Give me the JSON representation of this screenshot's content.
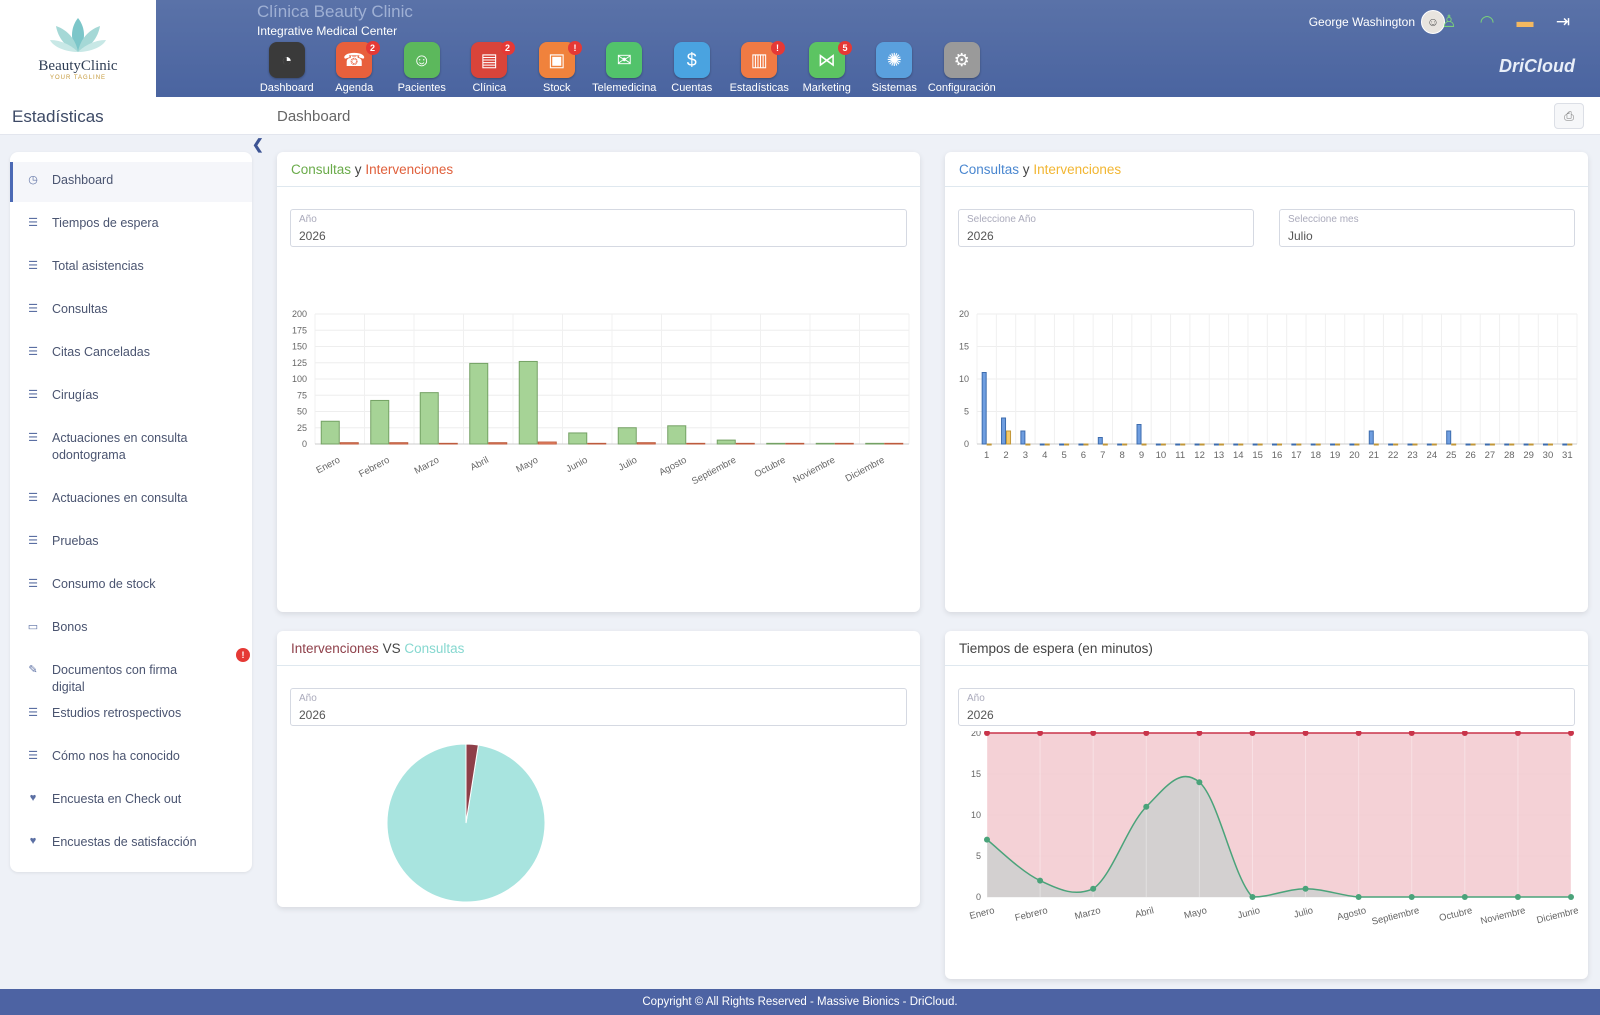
{
  "brand": {
    "logo_name": "BeautyClinic",
    "logo_tagline": "YOUR TAGLINE",
    "clinic_name": "Clínica Beauty Clinic",
    "clinic_sub": "Integrative Medical Center",
    "cloud": "DriCloud"
  },
  "nav": [
    {
      "label": "Dashboard",
      "color": "#3a3a3a",
      "icon": "◔",
      "badge": ""
    },
    {
      "label": "Agenda",
      "color": "#e8603c",
      "icon": "☎",
      "badge": "2"
    },
    {
      "label": "Pacientes",
      "color": "#5cb85c",
      "icon": "☺",
      "badge": ""
    },
    {
      "label": "Clínica",
      "color": "#d9443a",
      "icon": "▤",
      "badge": "2"
    },
    {
      "label": "Stock",
      "color": "#f0823c",
      "icon": "▣",
      "badge": "!"
    },
    {
      "label": "Telemedicina",
      "color": "#52c36b",
      "icon": "✉",
      "badge": ""
    },
    {
      "label": "Cuentas",
      "color": "#4aa3e0",
      "icon": "$",
      "badge": ""
    },
    {
      "label": "Estadísticas",
      "color": "#f07a44",
      "icon": "▥",
      "badge": "!"
    },
    {
      "label": "Marketing",
      "color": "#5cc462",
      "icon": "⋈",
      "badge": "5"
    },
    {
      "label": "Sistemas",
      "color": "#5aa0dd",
      "icon": "✺",
      "badge": ""
    },
    {
      "label": "Configuración",
      "color": "#9a9a9a",
      "icon": "⚙",
      "badge": ""
    }
  ],
  "user": {
    "name": "George Washington"
  },
  "page": {
    "section": "Estadísticas",
    "breadcrumb": "Dashboard"
  },
  "sidebar": [
    {
      "label": "Dashboard",
      "icon": "◷",
      "active": true
    },
    {
      "label": "Tiempos de espera",
      "icon": "☰"
    },
    {
      "label": "Total asistencias",
      "icon": "☰"
    },
    {
      "label": "Consultas",
      "icon": "☰"
    },
    {
      "label": "Citas Canceladas",
      "icon": "☰"
    },
    {
      "label": "Cirugías",
      "icon": "☰"
    },
    {
      "label": "Actuaciones en consulta odontograma",
      "icon": "☰"
    },
    {
      "label": "Actuaciones en consulta",
      "icon": "☰"
    },
    {
      "label": "Pruebas",
      "icon": "☰"
    },
    {
      "label": "Consumo de stock",
      "icon": "☰"
    },
    {
      "label": "Bonos",
      "icon": "▭"
    },
    {
      "label": "Documentos con firma digital",
      "icon": "✎",
      "badge": "!"
    },
    {
      "label": "Estudios retrospectivos",
      "icon": "☰"
    },
    {
      "label": "Cómo nos ha conocido",
      "icon": "☰"
    },
    {
      "label": "Encuesta en Check out",
      "icon": "♥"
    },
    {
      "label": "Encuestas de satisfacción",
      "icon": "♥"
    }
  ],
  "cards": {
    "c1": {
      "title_a": "Consultas",
      "title_mid": " y ",
      "title_b": "Intervenciones",
      "field_label": "Año",
      "field_value": "2026"
    },
    "c2": {
      "title_a": "Consultas",
      "title_mid": " y ",
      "title_b": "Intervenciones",
      "field1_label": "Seleccione Año",
      "field1_value": "2026",
      "field2_label": "Seleccione mes",
      "field2_value": "Julio"
    },
    "c3": {
      "title_a": "Intervenciones",
      "title_mid": " VS ",
      "title_b": "Consultas",
      "field_label": "Año",
      "field_value": "2026"
    },
    "c4": {
      "title": "Tiempos de espera (en minutos)",
      "field_label": "Año",
      "field_value": "2026"
    }
  },
  "footer": "Copyright © All Rights Reserved - Massive Bionics - DriCloud.",
  "chart_data": [
    {
      "type": "bar",
      "categories": [
        "Enero",
        "Febrero",
        "Marzo",
        "Abril",
        "Mayo",
        "Junio",
        "Julio",
        "Agosto",
        "Septiembre",
        "Octubre",
        "Noviembre",
        "Diciembre"
      ],
      "series": [
        {
          "values": [
            35,
            67,
            79,
            124,
            127,
            17,
            25,
            28,
            6,
            1,
            1,
            1
          ],
          "color": "#a6d396"
        },
        {
          "values": [
            2,
            2,
            1,
            2,
            3,
            1,
            2,
            1,
            1,
            1,
            1,
            1
          ],
          "color": "#ef8d6f"
        }
      ],
      "ylim": [
        0,
        200
      ],
      "yticks": [
        0,
        25,
        50,
        75,
        100,
        125,
        150,
        175,
        200
      ]
    },
    {
      "type": "bar",
      "categories": [
        "1",
        "2",
        "3",
        "4",
        "5",
        "6",
        "7",
        "8",
        "9",
        "10",
        "11",
        "12",
        "13",
        "14",
        "15",
        "16",
        "17",
        "18",
        "19",
        "20",
        "21",
        "22",
        "23",
        "24",
        "25",
        "26",
        "27",
        "28",
        "29",
        "30",
        "31"
      ],
      "series": [
        {
          "values": [
            11,
            4,
            2,
            0,
            0,
            0,
            1,
            0,
            3,
            0,
            0,
            0,
            0,
            0,
            0,
            0,
            0,
            0,
            0,
            0,
            2,
            0,
            0,
            0,
            2,
            0,
            0,
            0,
            0,
            0,
            0
          ],
          "color": "#6f9ee0"
        },
        {
          "values": [
            0,
            2,
            0,
            0,
            0,
            0,
            0,
            0,
            0,
            0,
            0,
            0,
            0,
            0,
            0,
            0,
            0,
            0,
            0,
            0,
            0,
            0,
            0,
            0,
            0,
            0,
            0,
            0,
            0,
            0,
            0
          ],
          "color": "#f4c96a"
        }
      ],
      "ylim": [
        0,
        20
      ],
      "yticks": [
        0,
        5,
        10,
        15,
        20
      ]
    },
    {
      "type": "pie",
      "slices": [
        {
          "value": 97.5,
          "color": "#a8e4df"
        },
        {
          "value": 2.5,
          "color": "#8e3f49"
        }
      ]
    },
    {
      "type": "area",
      "categories": [
        "Enero",
        "Febrero",
        "Marzo",
        "Abril",
        "Mayo",
        "Junio",
        "Julio",
        "Agosto",
        "Septiembre",
        "Octubre",
        "Noviembre",
        "Diciembre"
      ],
      "series": [
        {
          "values": [
            20,
            20,
            20,
            20,
            20,
            20,
            20,
            20,
            20,
            20,
            20,
            20
          ],
          "color": "#c9344a",
          "fill": "#f2c9cf"
        },
        {
          "values": [
            7,
            2,
            1,
            11,
            14,
            0,
            1,
            0,
            0,
            0,
            0,
            0
          ],
          "color": "#4aa37a",
          "fill": "#cfcfcf"
        }
      ],
      "ylim": [
        0,
        20
      ],
      "yticks": [
        0,
        5,
        10,
        15,
        20
      ]
    }
  ]
}
